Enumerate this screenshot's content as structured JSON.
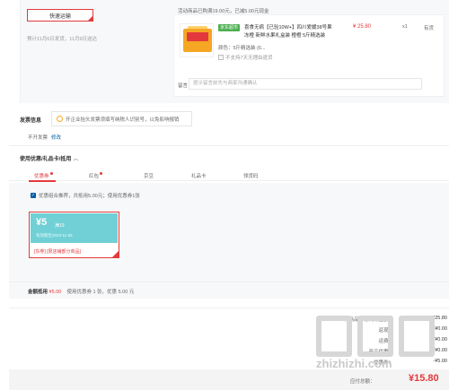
{
  "order": {
    "shipping_button": "快速运输",
    "eta": "预计11月6日发货，11月9日送达",
    "promo_line": "活动商品已购满19.00元，已减5.00元现金",
    "product": {
      "tag": "京东超市",
      "title": "喜食无病【已验10W+】四川爱媛38号果冻橙 新鲜水果礼盒装 橙橙 5斤精选装",
      "spec": "颜色：5斤精选装 (6...",
      "no_return": "不支持7天无理由退货",
      "price": "¥ 25.80",
      "qty": "x1",
      "stock": "有货"
    },
    "remark_label": "留言：",
    "remark_placeholder": "提示留言前先与商家沟通确认"
  },
  "invoice": {
    "title": "发票信息",
    "tip": "开企业抬头发票须填写纳税人识别号，以免影响报销",
    "none": "不开发票",
    "edit": "修改"
  },
  "coupons": {
    "title": "使用优惠/礼品卡/抵用",
    "tabs": [
      {
        "label": "优惠券",
        "dot": true
      },
      {
        "label": "红包",
        "dot": true
      },
      {
        "label": "京豆",
        "dot": false
      },
      {
        "label": "礼品卡",
        "dot": false
      },
      {
        "label": "领货码",
        "dot": false
      }
    ],
    "recommend": "优惠组合推荐，共抵用5.00元；使用优惠券1张",
    "coupon": {
      "amount": "¥5",
      "condition": "满19",
      "valid": "有效期至2023-11-05",
      "scope": "[东券] [限店铺部分商品]"
    },
    "summary_label": "金额抵用",
    "summary_amount": "¥5.00",
    "summary_detail": "使用优惠券 1 张，优惠 5.00 元"
  },
  "totals": {
    "rows": [
      {
        "label": "1件商品，总商品金额：",
        "value": "¥25.80"
      },
      {
        "label": "返现：",
        "value": "¥0.00"
      },
      {
        "label": "运费：",
        "value": "¥0.00"
      },
      {
        "label": "商品优惠：",
        "value": "¥0.00"
      },
      {
        "label": "优惠券：",
        "value": "-¥5.00"
      }
    ],
    "pay_label": "应付总额：",
    "pay_value": "¥15.80"
  },
  "watermark": {
    "text": "zhizhizhi.com"
  }
}
